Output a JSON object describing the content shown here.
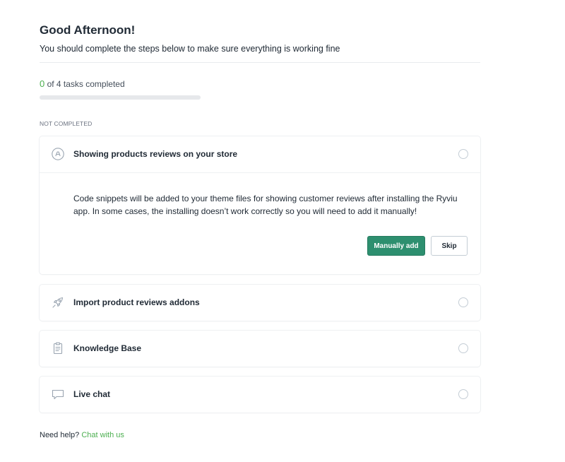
{
  "header": {
    "greeting": "Good Afternoon!",
    "subtitle": "You should complete the steps below to make sure everything is working fine"
  },
  "progress": {
    "completed": "0",
    "suffix": " of 4 tasks completed",
    "fraction": 0
  },
  "section_label": "NOT COMPLETED",
  "tasks": [
    {
      "title": "Showing products reviews on your store",
      "icon": "review-badge-icon",
      "expanded": true,
      "description": "Code snippets will be added to your theme files for showing customer reviews after installing the Ryviu app. In some cases, the installing doesn’t work correctly so you will need to add it manually!",
      "primary_label": "Manually add",
      "secondary_label": "Skip"
    },
    {
      "title": "Import product reviews addons",
      "icon": "rocket-icon"
    },
    {
      "title": "Knowledge Base",
      "icon": "clipboard-icon"
    },
    {
      "title": "Live chat",
      "icon": "chat-bubble-icon"
    }
  ],
  "help": {
    "text": "Need help?",
    "link": "Chat with us"
  },
  "colors": {
    "accent": "#2d8f6f",
    "link": "#4caf50"
  }
}
